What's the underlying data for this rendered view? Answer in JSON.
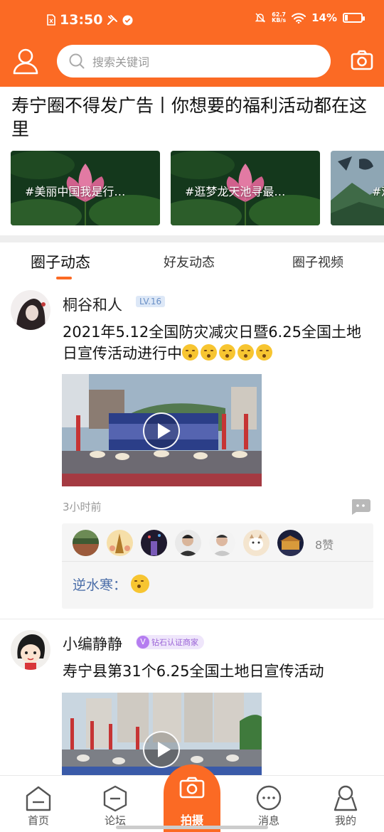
{
  "status_bar": {
    "time": "13:50",
    "net_speed_value": "62.7",
    "net_speed_unit": "KB/s",
    "battery": "14%"
  },
  "header": {
    "search_placeholder": "搜索关键词"
  },
  "banner": {
    "title": "寿宁圈不得发广告丨你想要的福利活动都在这里",
    "topics": [
      {
        "label": "#美丽中国我是行…"
      },
      {
        "label": "#逛梦龙天池寻最…"
      },
      {
        "label": "#观"
      }
    ]
  },
  "tabs": [
    {
      "label": "圈子动态",
      "active": true
    },
    {
      "label": "好友动态",
      "active": false
    },
    {
      "label": "圈子视频",
      "active": false
    }
  ],
  "posts": [
    {
      "author": "桐谷和人",
      "level": "LV.16",
      "text": "2021年5.12全国防灾减灾日暨6.25全国土地日宣传活动进行中",
      "emoji_icon": "shushing-face-emoji",
      "emoji_count": 5,
      "time_ago": "3小时前",
      "likes": "8赞",
      "like_avatar_count": 8,
      "comment": {
        "user": "逆水寒",
        "separator": "："
      }
    },
    {
      "author": "小编静静",
      "badge": "钻石认证商家",
      "badge_icon": "V",
      "text": "寿宁县第31个6.25全国土地日宣传活动"
    }
  ],
  "nav": {
    "items": [
      {
        "label": "首页",
        "icon": "home-icon"
      },
      {
        "label": "论坛",
        "icon": "forum-icon"
      },
      {
        "label": "拍摄",
        "icon": "camera-icon"
      },
      {
        "label": "消息",
        "icon": "message-icon"
      },
      {
        "label": "我的",
        "icon": "profile-icon"
      }
    ]
  },
  "colors": {
    "accent": "#fb6a24",
    "link": "#4a6da8",
    "level_badge": "#6a90c6",
    "merchant_badge": "#9a63d6"
  }
}
